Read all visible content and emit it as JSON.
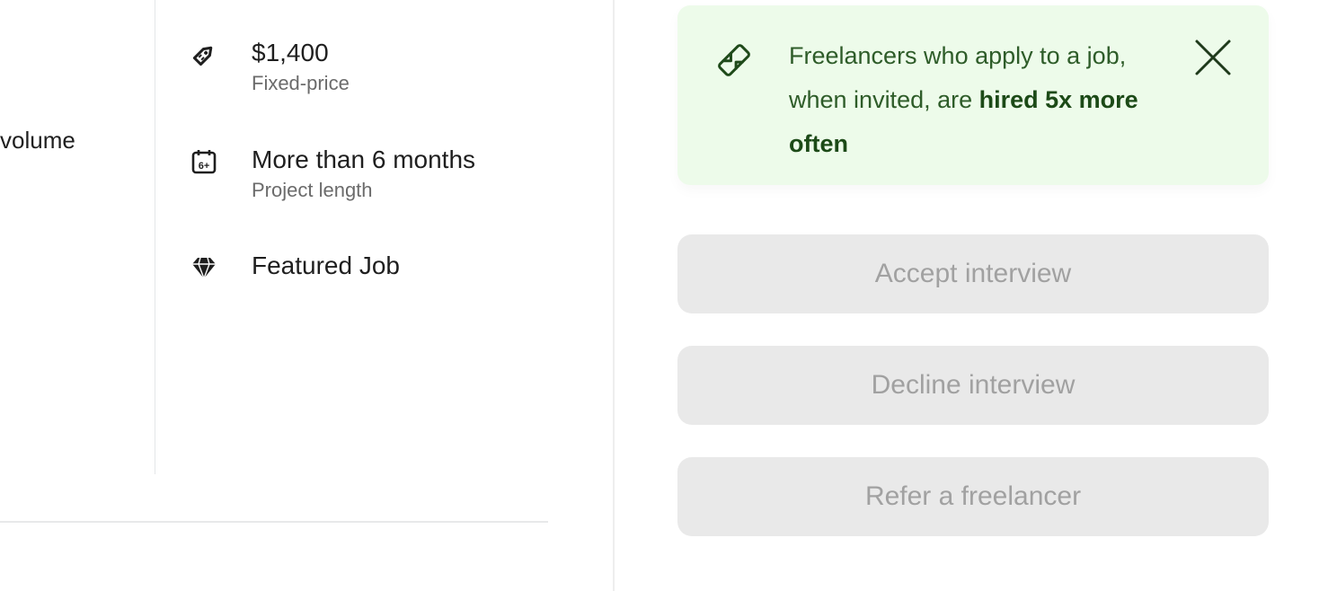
{
  "left": {
    "partial_text": "volume"
  },
  "details": [
    {
      "icon": "price-tag-icon",
      "value": "$1,400",
      "sub": "Fixed-price"
    },
    {
      "icon": "calendar-6plus-icon",
      "value": "More than 6 months",
      "sub": "Project length"
    },
    {
      "icon": "diamond-icon",
      "value": "Featured Job",
      "sub": ""
    }
  ],
  "calendar_badge": "6+",
  "tip": {
    "icon": "handshake-icon",
    "text_before": "Freelancers who apply to a job, when invited, are ",
    "text_bold": "hired 5x more often",
    "close_icon": "close-icon",
    "background": "#edfbea",
    "text_color": "#2e5c29"
  },
  "buttons": {
    "accept": "Accept interview",
    "decline": "Decline interview",
    "refer": "Refer a freelancer"
  },
  "colors": {
    "button_disabled_bg": "#e9e9e9",
    "button_disabled_text": "#a1a1a1"
  }
}
